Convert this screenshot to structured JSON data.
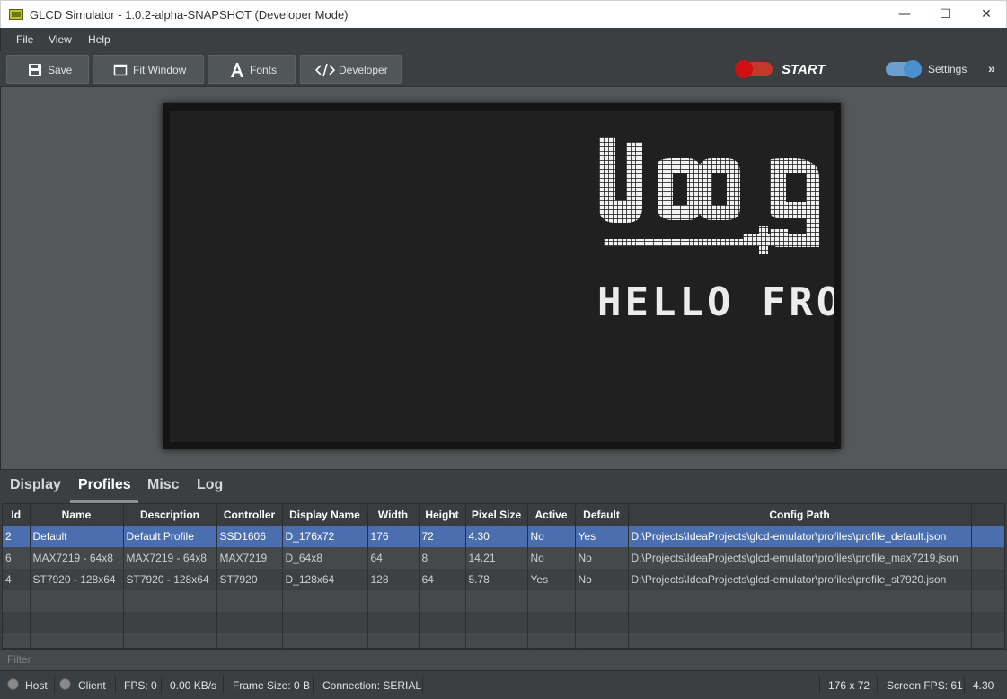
{
  "window": {
    "title": "GLCD Simulator - 1.0.2-alpha-SNAPSHOT (Developer Mode)",
    "minimize": "—",
    "maximize": "☐",
    "close": "✕"
  },
  "menu": [
    "File",
    "View",
    "Help"
  ],
  "toolbar": {
    "save_label": "Save",
    "fit_label": "Fit Window",
    "fonts_label": "Fonts",
    "developer_label": "Developer",
    "start_label": "START",
    "start_on": false,
    "settings_label": "Settings",
    "settings_on": true
  },
  "display": {
    "text": "HELLO FRO"
  },
  "tabs": [
    "Display",
    "Profiles",
    "Misc",
    "Log"
  ],
  "active_tab": "Profiles",
  "table": {
    "columns": [
      "Id",
      "Name",
      "Description",
      "Controller",
      "Display Name",
      "Width",
      "Height",
      "Pixel Size",
      "Active",
      "Default",
      "Config Path"
    ],
    "rows": [
      [
        "2",
        "Default",
        "Default Profile",
        "SSD1606",
        "D_176x72",
        "176",
        "72",
        "4.30",
        "No",
        "Yes",
        "D:\\Projects\\IdeaProjects\\glcd-emulator\\profiles\\profile_default.json"
      ],
      [
        "6",
        "MAX7219 - 64x8",
        "MAX7219 - 64x8",
        "MAX7219",
        "D_64x8",
        "64",
        "8",
        "14.21",
        "No",
        "No",
        "D:\\Projects\\IdeaProjects\\glcd-emulator\\profiles\\profile_max7219.json"
      ],
      [
        "4",
        "ST7920 - 128x64",
        "ST7920 - 128x64",
        "ST7920",
        "D_128x64",
        "128",
        "64",
        "5.78",
        "Yes",
        "No",
        "D:\\Projects\\IdeaProjects\\glcd-emulator\\profiles\\profile_st7920.json"
      ]
    ],
    "selected_row": 0
  },
  "filter": {
    "placeholder": "Filter"
  },
  "status": {
    "host_label": "Host",
    "client_label": "Client",
    "fps": "FPS: 0",
    "rate": "0.00 KB/s",
    "frame_size": "Frame Size: 0 B",
    "connection": "Connection: SERIAL",
    "resolution": "176 x 72",
    "screen_fps": "Screen FPS: 61",
    "pixel_size": "4.30"
  }
}
